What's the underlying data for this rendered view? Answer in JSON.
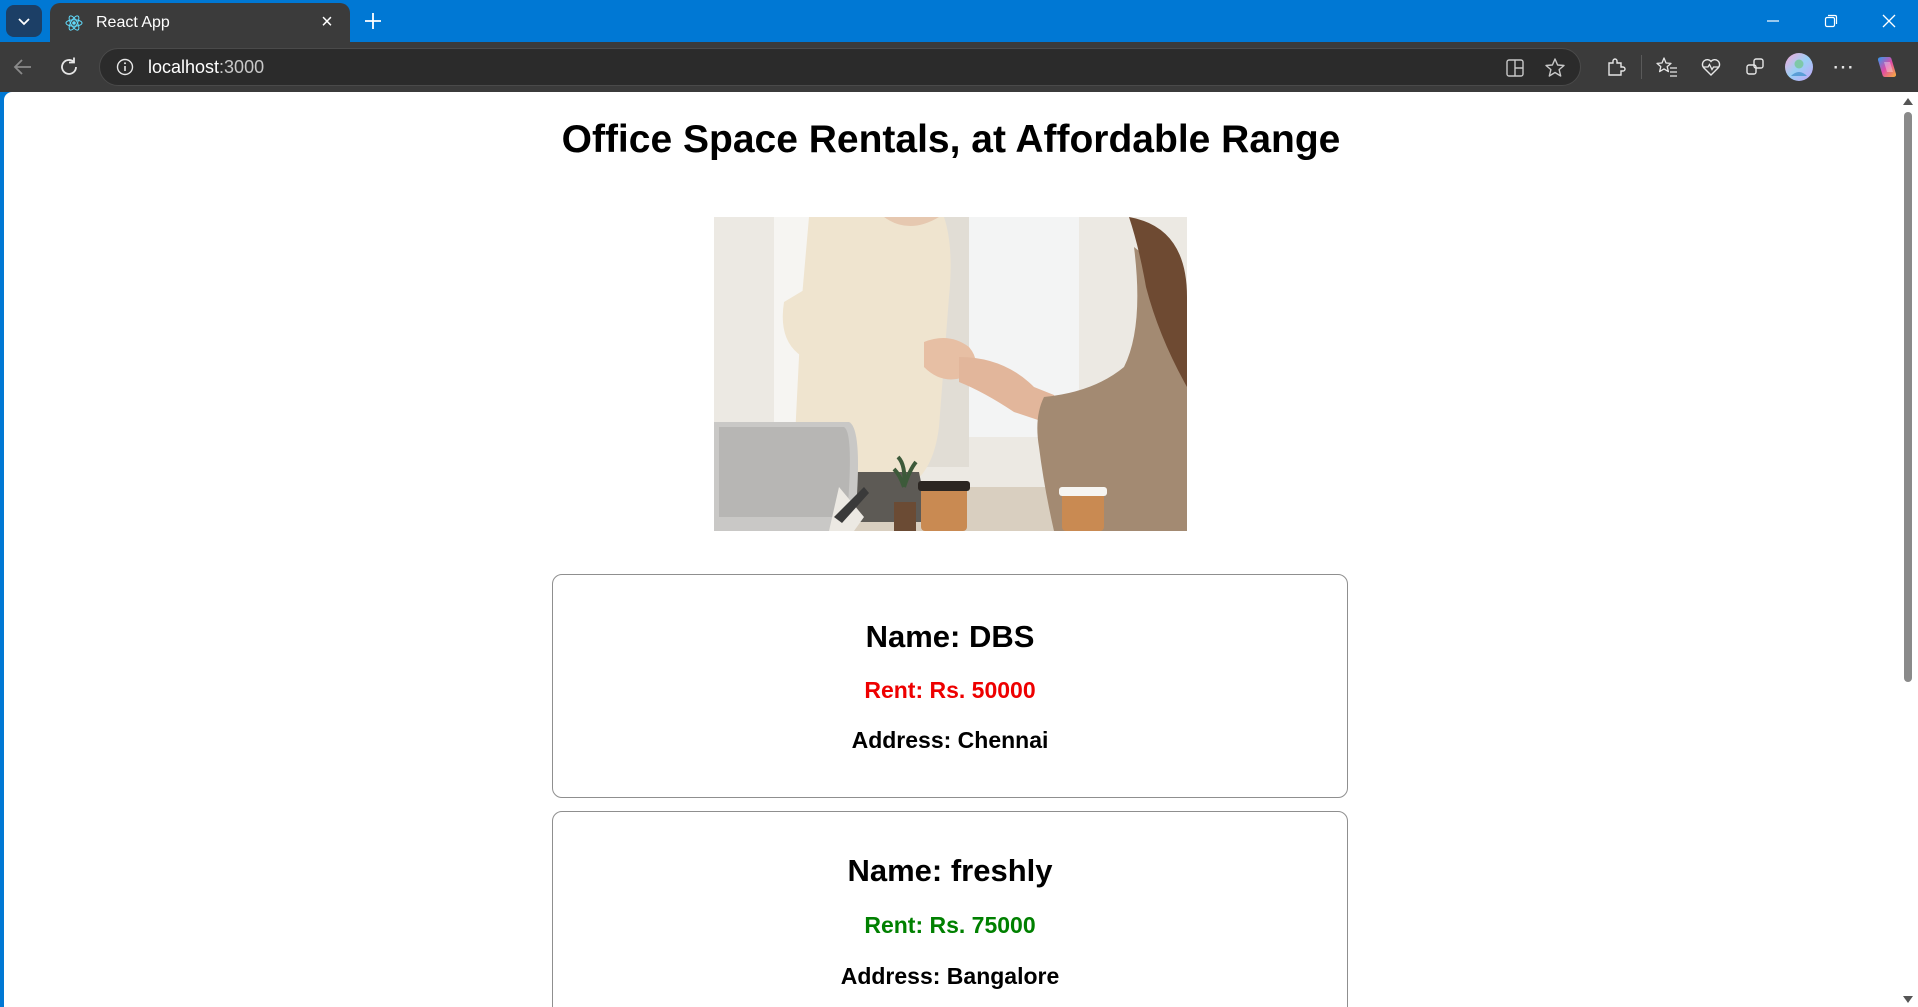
{
  "browser": {
    "tab_title": "React App",
    "tab_close": "×",
    "new_tab": "+",
    "url_host": "localhost",
    "url_port": ":3000",
    "more_label": "⋯"
  },
  "page": {
    "title": "Office Space Rentals, at Affordable Range",
    "hero_image": "handshake-office-photo"
  },
  "offices": [
    {
      "name_label": "Name: DBS",
      "rent_label": "Rent: Rs. 50000",
      "rent_color": "#ee0000",
      "address_label": "Address: Chennai"
    },
    {
      "name_label": "Name: freshly",
      "rent_label": "Rent: Rs. 75000",
      "rent_color": "#008000",
      "address_label": "Address: Bangalore"
    }
  ],
  "colors": {
    "titlebar": "#0078d4",
    "toolbar": "#3b3b3b",
    "rent_low": "#ee0000",
    "rent_high": "#008000"
  }
}
